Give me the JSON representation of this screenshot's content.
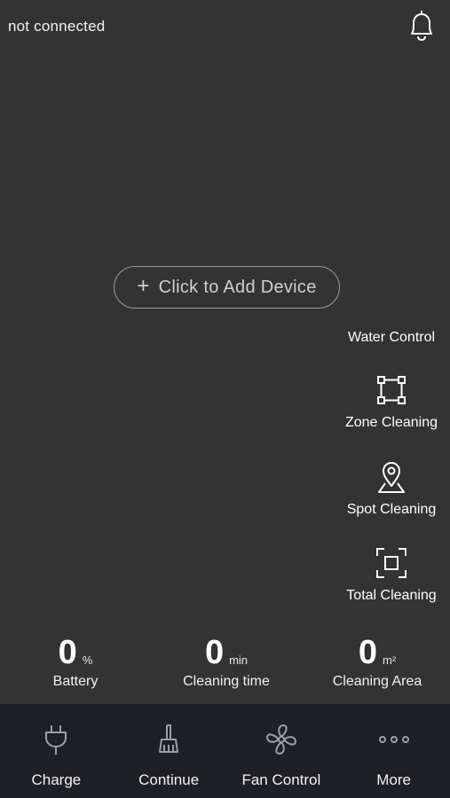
{
  "header": {
    "status": "not connected",
    "bell_icon": "bell-icon"
  },
  "add_device": {
    "plus": "+",
    "label": "Click to Add Device"
  },
  "modes": [
    {
      "label": "Water Control",
      "icon": "water-icon"
    },
    {
      "label": "Zone Cleaning",
      "icon": "zone-icon"
    },
    {
      "label": "Spot Cleaning",
      "icon": "location-pin-icon"
    },
    {
      "label": "Total Cleaning",
      "icon": "total-frame-icon"
    }
  ],
  "stats": {
    "battery": {
      "value": "0",
      "unit": "%",
      "label": "Battery"
    },
    "time": {
      "value": "0",
      "unit": "min",
      "label": "Cleaning time"
    },
    "area": {
      "value": "0",
      "unit": "m²",
      "label": "Cleaning Area"
    }
  },
  "bottom_nav": [
    {
      "label": "Charge",
      "icon": "plug-icon"
    },
    {
      "label": "Continue",
      "icon": "broom-icon"
    },
    {
      "label": "Fan Control",
      "icon": "fan-icon"
    },
    {
      "label": "More",
      "icon": "more-dots-icon"
    }
  ],
  "colors": {
    "background": "#333333",
    "bottom_bar": "#1e2026",
    "text": "#ffffff",
    "pill_border": "#9a9a9a"
  }
}
